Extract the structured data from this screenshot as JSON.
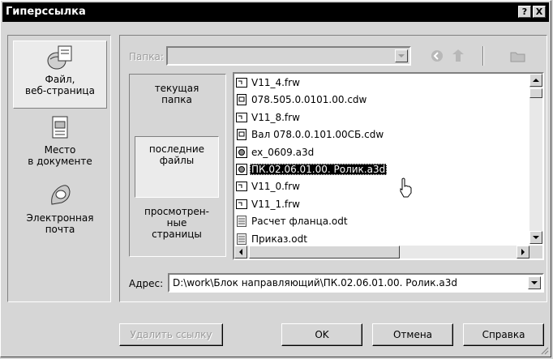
{
  "window": {
    "title": "Гиперссылка",
    "help_btn": "?",
    "close_btn": "X"
  },
  "sidebar": {
    "items": [
      {
        "label": "Файл,\nвеб-страница",
        "icon": "web-file-icon"
      },
      {
        "label": "Место\nв документе",
        "icon": "document-place-icon"
      },
      {
        "label": "Электронная\nпочта",
        "icon": "email-icon"
      }
    ]
  },
  "folder": {
    "label": "Папка:",
    "value": ""
  },
  "nav": {
    "items": [
      {
        "label": "текущая\nпапка"
      },
      {
        "label": "последние\nфайлы"
      },
      {
        "label": "просмотрен-\nные\nстраницы"
      }
    ]
  },
  "files": [
    {
      "name": "V11_4.frw",
      "type": "frw"
    },
    {
      "name": "078.505.0.0101.00.cdw",
      "type": "cdw"
    },
    {
      "name": "V11_8.frw",
      "type": "frw"
    },
    {
      "name": "Вал 078.0.0.101.00СБ.cdw",
      "type": "cdw"
    },
    {
      "name": "ex_0609.a3d",
      "type": "a3d"
    },
    {
      "name": "ПК.02.06.01.00. Ролик.a3d",
      "type": "a3d",
      "selected": true
    },
    {
      "name": "V11_0.frw",
      "type": "frw"
    },
    {
      "name": "V11_1.frw",
      "type": "frw"
    },
    {
      "name": "Расчет фланца.odt",
      "type": "odt"
    },
    {
      "name": "Приказ.odt",
      "type": "odt"
    }
  ],
  "address": {
    "label": "Адрес:",
    "value": "D:\\work\\Блок направляющий\\ПК.02.06.01.00. Ролик.a3d"
  },
  "buttons": {
    "remove_link": "Удалить ссылку",
    "ok": "OK",
    "cancel": "Отмена",
    "help": "Справка"
  },
  "colors": {
    "dialog_bg": "#d6d6d6",
    "title_bg": "#000000",
    "selection_bg": "#000000"
  }
}
